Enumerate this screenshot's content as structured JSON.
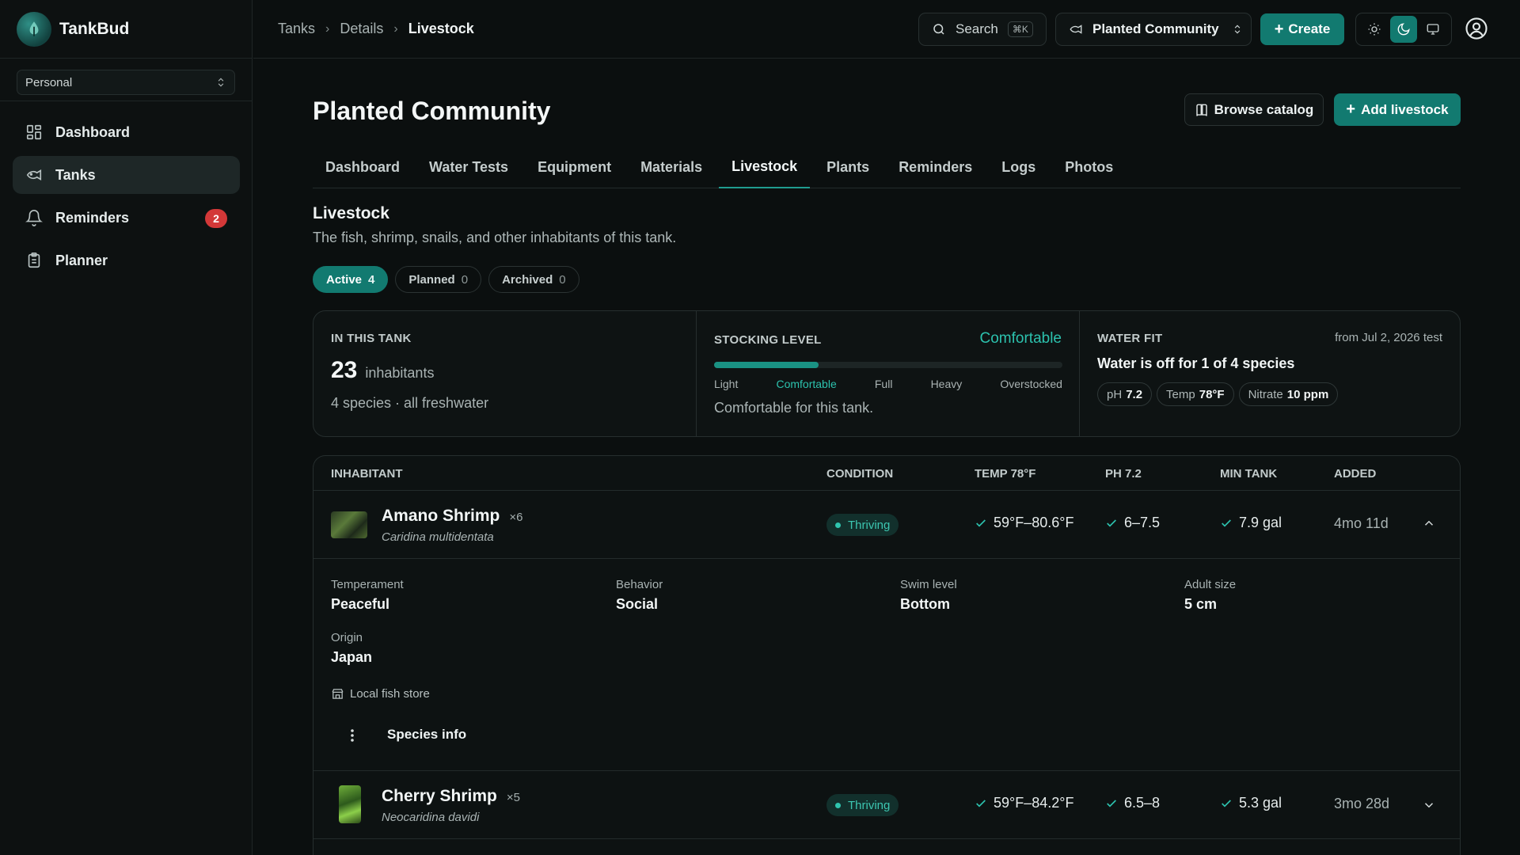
{
  "app": {
    "name": "TankBud",
    "workspace": "Personal"
  },
  "sidebar": {
    "items": [
      {
        "label": "Dashboard",
        "icon": "dashboard-icon"
      },
      {
        "label": "Tanks",
        "icon": "tank-icon",
        "active": true
      },
      {
        "label": "Reminders",
        "icon": "bell-icon",
        "badge": "2"
      },
      {
        "label": "Planner",
        "icon": "clipboard-icon"
      }
    ]
  },
  "topbar": {
    "breadcrumbs": [
      "Tanks",
      "Details",
      "Livestock"
    ],
    "search_label": "Search",
    "search_shortcut": "⌘K",
    "tank_selected": "Planted Community",
    "create_label": "Create"
  },
  "page": {
    "title": "Planted Community",
    "browse_label": "Browse catalog",
    "add_label": "Add livestock",
    "tabs": [
      "Dashboard",
      "Water Tests",
      "Equipment",
      "Materials",
      "Livestock",
      "Plants",
      "Reminders",
      "Logs",
      "Photos"
    ],
    "active_tab": "Livestock",
    "section_title": "Livestock",
    "section_subtitle": "The fish, shrimp, snails, and other inhabitants of this tank.",
    "filters": [
      {
        "label": "Active",
        "count": "4",
        "active": true
      },
      {
        "label": "Planned",
        "count": "0"
      },
      {
        "label": "Archived",
        "count": "0"
      }
    ]
  },
  "summary": {
    "in_tank": {
      "label": "IN THIS TANK",
      "count": "23",
      "count_unit": "inhabitants",
      "detail": "4 species · all freshwater"
    },
    "stocking": {
      "label": "STOCKING LEVEL",
      "status": "Comfortable",
      "fill_fraction": 0.3,
      "scale": [
        "Light",
        "Comfortable",
        "Full",
        "Heavy",
        "Overstocked"
      ],
      "active_scale": "Comfortable",
      "note": "Comfortable for this tank."
    },
    "water_fit": {
      "label": "WATER FIT",
      "source": "from Jul 2, 2026 test",
      "headline": "Water is off for 1 of 4 species",
      "chips": [
        {
          "label": "pH",
          "value": "7.2"
        },
        {
          "label": "Temp",
          "value": "78°F"
        },
        {
          "label": "Nitrate",
          "value": "10 ppm"
        }
      ]
    }
  },
  "table": {
    "headers": [
      "INHABITANT",
      "CONDITION",
      "TEMP 78°F",
      "PH 7.2",
      "MIN TANK",
      "ADDED"
    ],
    "rows": [
      {
        "name": "Amano Shrimp",
        "qty": "×6",
        "scientific": "Caridina multidentata",
        "condition": "Thriving",
        "temp": "59°F–80.6°F",
        "ph": "6–7.5",
        "min_tank": "7.9 gal",
        "added": "4mo 11d",
        "expanded": true
      },
      {
        "name": "Cherry Shrimp",
        "qty": "×5",
        "scientific": "Neocaridina davidi",
        "condition": "Thriving",
        "temp": "59°F–84.2°F",
        "ph": "6.5–8",
        "min_tank": "5.3 gal",
        "added": "3mo 28d",
        "expanded": false
      }
    ],
    "detail": {
      "temperament_label": "Temperament",
      "temperament": "Peaceful",
      "behavior_label": "Behavior",
      "behavior": "Social",
      "swim_label": "Swim level",
      "swim": "Bottom",
      "size_label": "Adult size",
      "size": "5 cm",
      "origin_label": "Origin",
      "origin": "Japan",
      "source": "Local fish store",
      "species_info_label": "Species info"
    }
  },
  "colors": {
    "accent": "#127a70",
    "accent_text": "#2cc2ae",
    "badge": "#d33838"
  }
}
